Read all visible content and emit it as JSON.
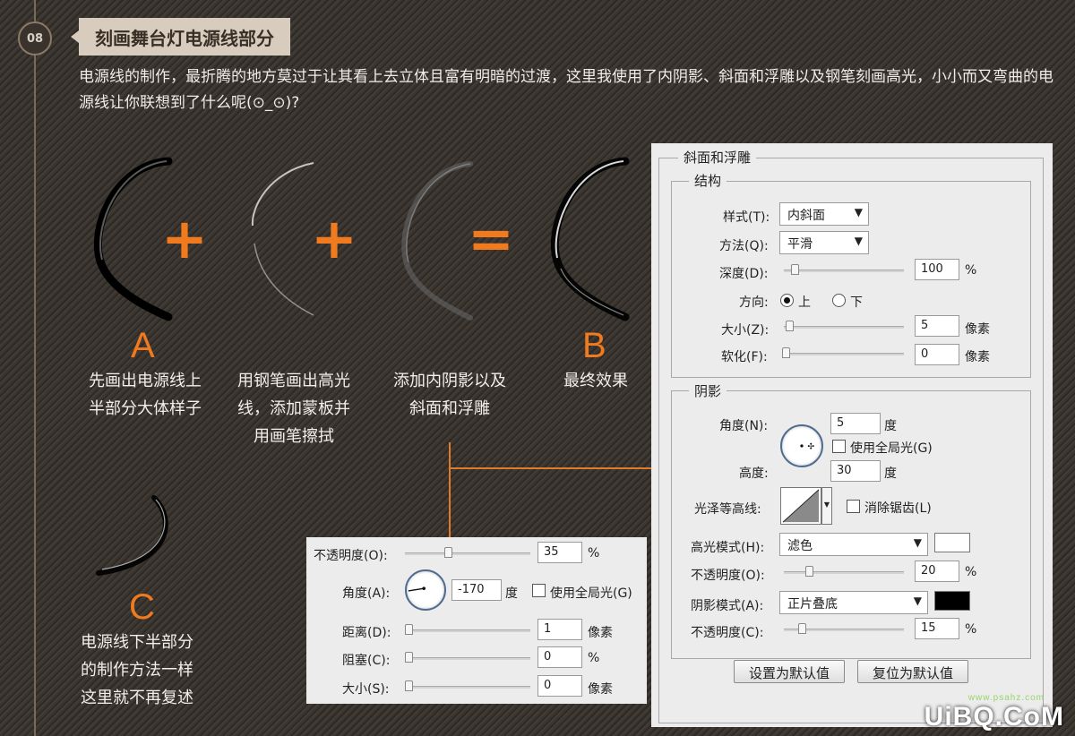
{
  "step": {
    "number": "08",
    "title": "刻画舞台灯电源线部分"
  },
  "intro": "电源线的制作，最折腾的地方莫过于让其看上去立体且富有明暗的过渡，这里我使用了内阴影、斜面和浮雕以及钢笔刻画高光，小小而又弯曲的电源线让你联想到了什么呢(⊙_⊙)?",
  "equation": {
    "plus1": "+",
    "plus2": "+",
    "equals": "=",
    "letters": {
      "a": "A",
      "b": "B",
      "c": "C"
    },
    "captions": {
      "a": [
        "先画出电源线上",
        "半部分大体样子"
      ],
      "step2": [
        "用钢笔画出高光",
        "线，添加蒙板并",
        "用画笔擦拭"
      ],
      "step3": [
        "添加内阴影以及",
        "斜面和浮雕"
      ],
      "b": [
        "最终效果"
      ],
      "c": [
        "电源线下半部分",
        "的制作方法一样",
        "这里就不再复述"
      ]
    }
  },
  "inner_shadow_panel": {
    "opacity_label": "不透明度(O):",
    "opacity_value": "35",
    "opacity_unit": "%",
    "opacity_level": 0.35,
    "angle_label": "角度(A):",
    "angle_value": "-170",
    "angle_unit": "度",
    "global_light": "使用全局光(G)",
    "distance_label": "距离(D):",
    "distance_value": "1",
    "distance_unit": "像素",
    "choke_label": "阻塞(C):",
    "choke_value": "0",
    "choke_unit": "%",
    "size_label": "大小(S):",
    "size_value": "0",
    "size_unit": "像素"
  },
  "bevel_panel": {
    "title": "斜面和浮雕",
    "structure": {
      "title": "结构",
      "style_label": "样式(T):",
      "style_value": "内斜面",
      "technique_label": "方法(Q):",
      "technique_value": "平滑",
      "depth_label": "深度(D):",
      "depth_value": "100",
      "depth_unit": "%",
      "direction_label": "方向:",
      "direction_up": "上",
      "direction_down": "下",
      "size_label": "大小(Z):",
      "size_value": "5",
      "size_unit": "像素",
      "soften_label": "软化(F):",
      "soften_value": "0",
      "soften_unit": "像素"
    },
    "shading": {
      "title": "阴影",
      "angle_label": "角度(N):",
      "angle_value": "5",
      "angle_unit": "度",
      "global_light": "使用全局光(G)",
      "altitude_label": "高度:",
      "altitude_value": "30",
      "altitude_unit": "度",
      "gloss_label": "光泽等高线:",
      "antialias": "消除锯齿(L)",
      "highlight_mode_label": "高光模式(H):",
      "highlight_mode_value": "滤色",
      "highlight_color": "#ffffff",
      "highlight_opacity_label": "不透明度(O):",
      "highlight_opacity_value": "20",
      "highlight_opacity_unit": "%",
      "shadow_mode_label": "阴影模式(A):",
      "shadow_mode_value": "正片叠底",
      "shadow_color": "#000000",
      "shadow_opacity_label": "不透明度(C):",
      "shadow_opacity_value": "15",
      "shadow_opacity_unit": "%"
    },
    "make_default": "设置为默认值",
    "reset_default": "复位为默认值"
  },
  "watermark": {
    "text": "UiBQ.CoM",
    "sub": "www.psahz.com"
  },
  "colors": {
    "accent": "#f07a1e",
    "panel": "#ececec"
  }
}
